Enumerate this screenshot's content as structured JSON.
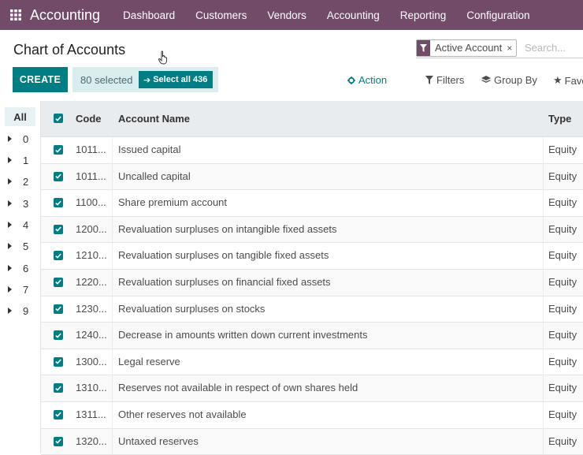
{
  "navbar": {
    "app_name": "Accounting",
    "menu": [
      "Dashboard",
      "Customers",
      "Vendors",
      "Accounting",
      "Reporting",
      "Configuration"
    ],
    "bg_color": "#714b67"
  },
  "control_panel": {
    "title": "Chart of Accounts",
    "create_label": "CREATE",
    "selected_text": "80 selected",
    "select_all_label": "Select all 436",
    "action_label": "Action",
    "filters_label": "Filters",
    "groupby_label": "Group By",
    "favorites_label": "Favo",
    "search": {
      "facet_label": "Active Account",
      "facet_close": "×",
      "placeholder": "Search..."
    }
  },
  "sidebar": {
    "all_label": "All",
    "items": [
      "0",
      "1",
      "2",
      "3",
      "4",
      "5",
      "6",
      "7",
      "9"
    ]
  },
  "table": {
    "headers": {
      "code": "Code",
      "name": "Account Name",
      "type": "Type"
    },
    "rows": [
      {
        "code": "1011...",
        "name": "Issued capital",
        "type": "Equity"
      },
      {
        "code": "1011...",
        "name": "Uncalled capital",
        "type": "Equity"
      },
      {
        "code": "1100...",
        "name": "Share premium account",
        "type": "Equity"
      },
      {
        "code": "1200...",
        "name": "Revaluation surpluses on intangible fixed assets",
        "type": "Equity"
      },
      {
        "code": "1210...",
        "name": "Revaluation surpluses on tangible fixed assets",
        "type": "Equity"
      },
      {
        "code": "1220...",
        "name": "Revaluation surpluses on financial fixed assets",
        "type": "Equity"
      },
      {
        "code": "1230...",
        "name": "Revaluation surpluses on stocks",
        "type": "Equity"
      },
      {
        "code": "1240...",
        "name": "Decrease in amounts written down current investments",
        "type": "Equity"
      },
      {
        "code": "1300...",
        "name": "Legal reserve",
        "type": "Equity"
      },
      {
        "code": "1310...",
        "name": "Reserves not available in respect of own shares held",
        "type": "Equity"
      },
      {
        "code": "1311...",
        "name": "Other reserves not available",
        "type": "Equity"
      },
      {
        "code": "1320...",
        "name": "Untaxed reserves",
        "type": "Equity"
      }
    ]
  },
  "colors": {
    "primary": "#017e84",
    "brand": "#714b67"
  }
}
